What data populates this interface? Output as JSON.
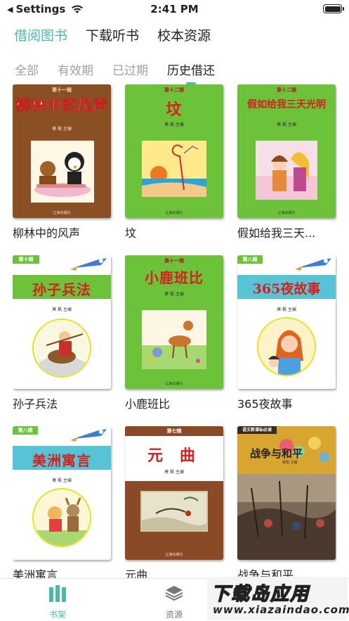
{
  "status_bar": {
    "back_label": "Settings",
    "time": "2:41 PM"
  },
  "main_tabs": [
    {
      "label": "借阅图书",
      "active": true
    },
    {
      "label": "下载听书",
      "active": false
    },
    {
      "label": "校本资源",
      "active": false
    }
  ],
  "sub_tabs": [
    {
      "label": "全部",
      "active": false
    },
    {
      "label": "有效期",
      "active": false
    },
    {
      "label": "已过期",
      "active": false
    },
    {
      "label": "历史借还",
      "active": true
    }
  ],
  "books": [
    {
      "title": "柳林中的风声",
      "cover": {
        "series": "第十一辑",
        "title": "柳林中的风声",
        "editor": "萧 枫 主编",
        "publisher": "辽海出版社",
        "bg": "#8a5024",
        "banner": "#8a5024"
      }
    },
    {
      "title": "坟",
      "cover": {
        "series": "第十二辑",
        "title": "坟",
        "editor": "萧 枫 主编",
        "publisher": "辽海出版社",
        "bg": "#6cc33a",
        "banner": "#6cc33a"
      }
    },
    {
      "title": "假如给我三天...",
      "cover": {
        "series": "第十二辑",
        "title": "假如给我三天光明",
        "editor": "萧 枫 主编",
        "publisher": "辽海出版社",
        "bg": "#6cc33a",
        "banner": "#6cc33a"
      }
    },
    {
      "title": "孙子兵法",
      "cover": {
        "series": "第十辑",
        "title": "孙子兵法",
        "editor": "萧 枫 主编",
        "publisher": "",
        "bg": "#ffffff",
        "banner": "#6cc33a"
      }
    },
    {
      "title": "小鹿班比",
      "cover": {
        "series": "第十一辑",
        "title": "小鹿班比",
        "editor": "萧 枫 主编",
        "publisher": "辽海出版社",
        "bg": "#6cc33a",
        "banner": "#6cc33a"
      }
    },
    {
      "title": "365夜故事",
      "cover": {
        "series": "第八辑",
        "title": "365夜故事",
        "editor": "萧 枫 主编",
        "publisher": "",
        "bg": "#ffffff",
        "banner": "#57c4d6"
      }
    },
    {
      "title": "美洲寓言",
      "cover": {
        "series": "第八辑",
        "title": "美洲寓言",
        "editor": "萧 枫 主编",
        "publisher": "",
        "bg": "#ffffff",
        "banner": "#57c4d6"
      }
    },
    {
      "title": "元曲",
      "cover": {
        "series": "第七辑",
        "title": "元 曲",
        "editor": "萧 枫 主编",
        "publisher": "辽海出版社",
        "bg": "#8a4a28",
        "banner": "#ffffff"
      }
    },
    {
      "title": "战争与和平",
      "cover": {
        "series": "语文新课标必读",
        "title": "战争与和平",
        "editor": "萧枫 主编",
        "publisher": "",
        "bg": "#d9a531",
        "banner": "#d9a531"
      }
    }
  ],
  "bottom_tabs": [
    {
      "label": "书架",
      "icon": "bookshelf-icon",
      "active": true
    },
    {
      "label": "资源",
      "icon": "layers-icon",
      "active": false
    }
  ],
  "watermark": {
    "big": "下载岛应用",
    "small": "www.xiazaindao.com"
  },
  "colors": {
    "accent": "#49b9b0",
    "inactive_tab": "#a0a0a0"
  }
}
